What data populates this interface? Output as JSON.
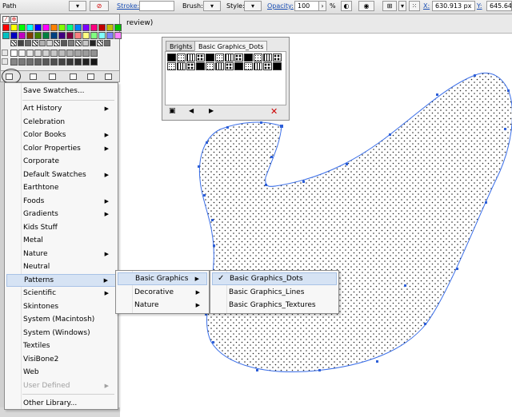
{
  "control_bar": {
    "object_type": "Path",
    "stroke_label": "Stroke:",
    "brush_label": "Brush:",
    "style_label": "Style:",
    "opacity_label": "Opacity:",
    "opacity_value": "100",
    "opacity_unit": "%",
    "x_label": "X:",
    "x_value": "630.913 px",
    "y_label": "Y:",
    "y_value": "645.64"
  },
  "document_tab": {
    "title_fragment": "review)"
  },
  "swatches_menu": {
    "save_swatches": "Save Swatches...",
    "items": [
      {
        "label": "Art History",
        "submenu": true
      },
      {
        "label": "Celebration",
        "submenu": false
      },
      {
        "label": "Color Books",
        "submenu": true
      },
      {
        "label": "Color Properties",
        "submenu": true
      },
      {
        "label": "Corporate",
        "submenu": false
      },
      {
        "label": "Default Swatches",
        "submenu": true
      },
      {
        "label": "Earthtone",
        "submenu": false
      },
      {
        "label": "Foods",
        "submenu": true
      },
      {
        "label": "Gradients",
        "submenu": true
      },
      {
        "label": "Kids Stuff",
        "submenu": false
      },
      {
        "label": "Metal",
        "submenu": false
      },
      {
        "label": "Nature",
        "submenu": true
      },
      {
        "label": "Neutral",
        "submenu": false
      },
      {
        "label": "Patterns",
        "submenu": true
      },
      {
        "label": "Scientific",
        "submenu": true
      },
      {
        "label": "Skintones",
        "submenu": false
      },
      {
        "label": "System (Macintosh)",
        "submenu": false
      },
      {
        "label": "System (Windows)",
        "submenu": false
      },
      {
        "label": "Textiles",
        "submenu": false
      },
      {
        "label": "VisiBone2",
        "submenu": false
      },
      {
        "label": "Web",
        "submenu": false
      },
      {
        "label": "User Defined",
        "submenu": true,
        "disabled": true
      }
    ],
    "other_library": "Other Library...",
    "highlighted": "Patterns"
  },
  "patterns_submenu": {
    "items": [
      {
        "label": "Basic Graphics",
        "submenu": true
      },
      {
        "label": "Decorative",
        "submenu": true
      },
      {
        "label": "Nature",
        "submenu": true
      }
    ],
    "highlighted": "Basic Graphics"
  },
  "basic_graphics_submenu": {
    "items": [
      {
        "label": "Basic Graphics_Dots",
        "checked": true
      },
      {
        "label": "Basic Graphics_Lines",
        "checked": false
      },
      {
        "label": "Basic Graphics_Textures",
        "checked": false
      }
    ],
    "check_mark": "✓"
  },
  "library_panel": {
    "tabs": [
      "Brights",
      "Basic Graphics_Dots"
    ],
    "active_tab": "Basic Graphics_Dots",
    "footer_icons": [
      "library-menu-icon",
      "previous-icon",
      "next-icon",
      "close-icon"
    ]
  },
  "colors": {
    "menu_highlight": "#d6e3f4",
    "path_stroke": "#3a6ee8",
    "anchor": "#2d5fd8",
    "link_text": "#1a4fb5"
  },
  "swatch_colors": [
    "#ff0000",
    "#ffff00",
    "#00ff00",
    "#00ffff",
    "#0000ff",
    "#ff00ff",
    "#ff8000",
    "#80ff00",
    "#00ff80",
    "#0080ff",
    "#8000ff",
    "#ff0080",
    "#c00000",
    "#c0c000",
    "#00c000",
    "#00c0c0",
    "#0000c0",
    "#c000c0",
    "#804000",
    "#408000",
    "#008040",
    "#004080",
    "#400080",
    "#800040",
    "#ff8080",
    "#ffff80",
    "#80ff80",
    "#80ffff",
    "#8080ff",
    "#ff80ff"
  ]
}
